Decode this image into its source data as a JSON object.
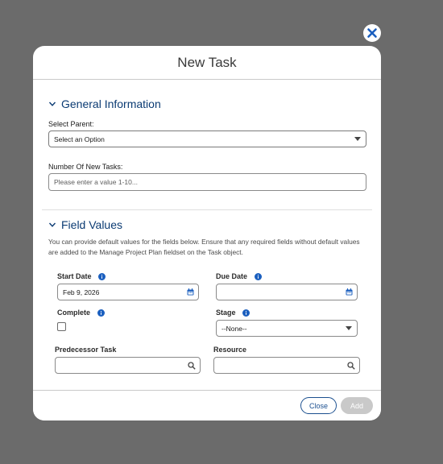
{
  "modal": {
    "title": "New Task"
  },
  "general": {
    "section_label": "General Information",
    "parent_label": "Select Parent:",
    "parent_value": "Select an Option",
    "num_tasks_label": "Number Of New Tasks:",
    "num_tasks_placeholder": "Please enter a value 1-10..."
  },
  "field_values": {
    "section_label": "Field Values",
    "help_text": "You can provide default values for the fields below. Ensure that any required fields without default values are added to the Manage Project Plan fieldset on the Task object.",
    "start_date_label": "Start Date",
    "start_date_value": "Feb 9, 2026",
    "due_date_label": "Due Date",
    "due_date_value": "",
    "complete_label": "Complete",
    "stage_label": "Stage",
    "stage_value": "--None--",
    "predecessor_label": "Predecessor Task",
    "resource_label": "Resource"
  },
  "footer": {
    "close_label": "Close",
    "add_label": "Add"
  },
  "icons": [
    "close-icon",
    "chevron-down-icon",
    "info-icon",
    "calendar-icon",
    "search-icon",
    "dropdown-arrow-icon"
  ],
  "colors": {
    "brand": "#0b3b73",
    "accent": "#1b5fbf",
    "overlay": "#6b6b6b"
  }
}
